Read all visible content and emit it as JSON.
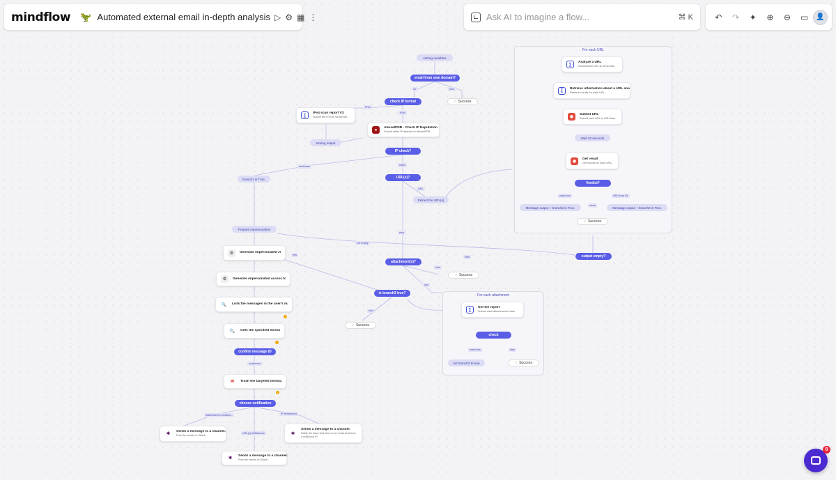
{
  "header": {
    "logo": "mindflow",
    "flow_icon": "🦖",
    "flow_title": "Automated external email in-depth analysis",
    "run_icon": "play-icon",
    "settings_icon": "gear-icon",
    "calendar_icon": "calendar-icon",
    "more_icon": "more-vertical-icon"
  },
  "ai": {
    "placeholder": "Ask AI to imagine a flow...",
    "shortcut": "⌘ K"
  },
  "toolbar": {
    "undo": "↶",
    "redo": "↷",
    "magic": "✦",
    "zoom_in": "⊕",
    "zoom_out": "⊖",
    "fit": "▭",
    "avatar": "👤"
  },
  "groups": {
    "url": "For each URL",
    "attachment": "For each attachment"
  },
  "nodes": {
    "setting_variables": "setting variables",
    "own_domain": "email from own domain?",
    "check_ip_format": "check IP format",
    "success_1": "Success",
    "ipv4_title": "IPv4 scan report V3",
    "ipv4_sub": "Submit the IPv4 to VirusTotal.",
    "abuse_title": "AbuseIPDB - Check IP Reputation",
    "abuse_sub": "Submit either IP address to AbuseIPDB",
    "storing_output": "storing output",
    "ip_check": "IP check?",
    "branch1": "branch1 is True.",
    "urls": "URL(s)?",
    "extract_urls": "Extract the URL(s)",
    "prepare_imp": "Prepare impersonation",
    "gen_jwt": "Generate impersonated JWT",
    "gen_token": "Generate impersonated access token",
    "list_messages": "Lists the messages in the user's mai...",
    "get_message": "Gets the specified message",
    "confirm_id": "confirm message ID",
    "trash": "Trash the targeted message",
    "choose_notif": "choose notification",
    "slack1_title": "Sends a message to a channel.",
    "slack1_sub": "Post the results on Slack.",
    "slack2_title": "Sends a message to a channel.",
    "slack2_sub": "Post the results on Slack.",
    "slack3_title": "Sends a message to a channel.",
    "slack3_sub": "Notify the team that there is an email sent from a malicious IP.",
    "attachments": "attachment(s)?",
    "success_2": "Success",
    "branch3_true": "is branch3 true?",
    "success_3": "Success",
    "output_empty": "output empty?",
    "analyze_url_title": "Analyze a URL",
    "analyze_url_sub": "Submit each URL to VirusTotal.",
    "retrieve_title": "Retrieve information about a URL ana...",
    "retrieve_sub": "Retrieve results for each URL.",
    "submit_url_title": "Submit URL",
    "submit_url_sub": "Submit each URL to URLScan.",
    "wait": "Wait 20 seconds",
    "get_result_title": "Get result",
    "get_result_sub": "Get reports on each URL.",
    "verdict": "Verdict?",
    "msg_branch2_a": "Message output + branch2 is True.",
    "msg_branch2_b": "Message output + branch2 is True.",
    "success_4": "Success",
    "file_report_title": "Get file report",
    "file_report_sub": "Submit each attachment's hash.",
    "check": "check",
    "set_branch3": "set branch3 to true",
    "success_5": "Success"
  },
  "edge_labels": {
    "no": "no",
    "else_1": "else",
    "ipv4": "IPv4",
    "ipv6": "IPv6",
    "malicious_1": "malicious",
    "clean_1": "clean",
    "url": "URL",
    "else_2": "else",
    "not_empty": "not empty",
    "yes_1": "yes",
    "else_3": "else",
    "else_4": "else",
    "yes_2": "yes",
    "malicious_2": "malicious",
    "clean_2": "clean",
    "urlscan_bl": "URLScan BL",
    "malicious_3": "malicious",
    "else_5": "else",
    "confirmed": "confirmed",
    "attachment_malicious": "Attachment is malicio...",
    "ip_malicious": "IP isMalicious",
    "urls_malicious": "URL(s) isMalicious"
  },
  "chat": {
    "badge": "8"
  }
}
